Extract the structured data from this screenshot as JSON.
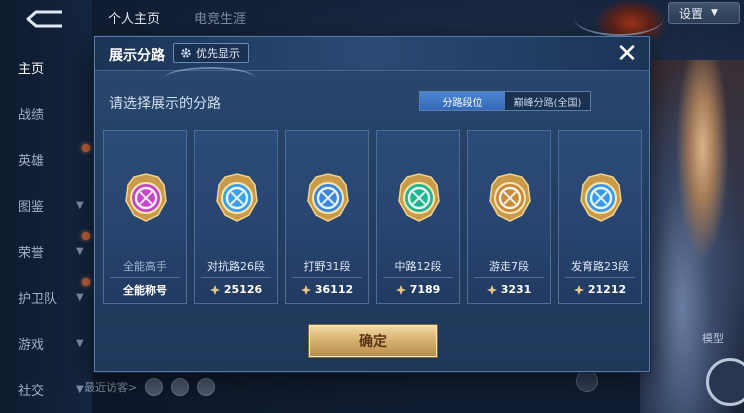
{
  "left_nav": {
    "items": [
      {
        "label": "主页",
        "active": true
      },
      {
        "label": "战绩"
      },
      {
        "label": "英雄"
      },
      {
        "label": "图鉴",
        "chevron": true
      },
      {
        "label": "荣誉",
        "chevron": true
      },
      {
        "label": "护卫队",
        "chevron": true
      },
      {
        "label": "游戏",
        "chevron": true
      },
      {
        "label": "社交",
        "chevron": true
      }
    ]
  },
  "top_tabs": [
    "个人主页",
    "电竞生涯"
  ],
  "settings": {
    "label": "设置"
  },
  "background": {
    "recent_visitors": "最近访客>",
    "hero_label": "模型"
  },
  "modal": {
    "title": "展示分路",
    "priority_chip": "优先显示",
    "subtitle": "请选择展示的分路",
    "segments": [
      {
        "label": "分路段位",
        "active": true
      },
      {
        "label": "巅峰分路(全国)",
        "active": false
      }
    ],
    "lanes": [
      {
        "rank": "全能高手",
        "score": "全能称号",
        "icon": "all-rounder-icon",
        "color": "#c447c8",
        "show_gem": false
      },
      {
        "rank": "对抗路26段",
        "score": "25126",
        "icon": "clash-lane-icon",
        "color": "#3aa0e8",
        "show_gem": true
      },
      {
        "rank": "打野31段",
        "score": "36112",
        "icon": "jungle-icon",
        "color": "#3a86e0",
        "show_gem": true
      },
      {
        "rank": "中路12段",
        "score": "7189",
        "icon": "mid-lane-icon",
        "color": "#1fb58f",
        "show_gem": true
      },
      {
        "rank": "游走7段",
        "score": "3231",
        "icon": "roam-icon",
        "color": "#c98a3a",
        "show_gem": true
      },
      {
        "rank": "发育路23段",
        "score": "21212",
        "icon": "farm-lane-icon",
        "color": "#3a9ae8",
        "show_gem": true
      }
    ],
    "confirm_label": "确定"
  }
}
